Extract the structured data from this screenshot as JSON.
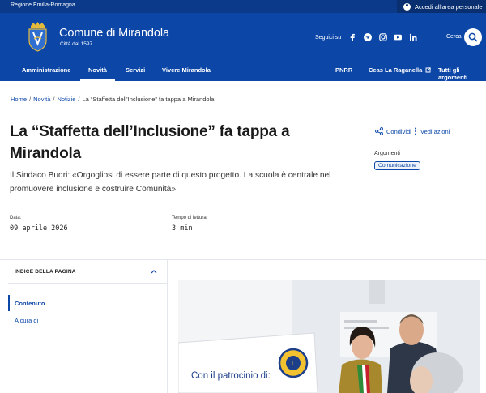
{
  "slim_header": {
    "region": "Regione Emilia-Romagna",
    "login": "Accedi all'area personale"
  },
  "brand": {
    "title": "Comune di Mirandola",
    "subtitle": "Città dal 1597"
  },
  "social": {
    "label": "Seguici su",
    "icons": [
      "facebook-icon",
      "telegram-icon",
      "instagram-icon",
      "youtube-icon",
      "linkedin-icon"
    ]
  },
  "search": {
    "label": "Cerca"
  },
  "nav": {
    "items": [
      "Amministrazione",
      "Novità",
      "Servizi",
      "Vivere Mirandola"
    ],
    "active": "Novità",
    "right_items": [
      "PNRR",
      "Ceas La Raganella",
      "Tutti gli argomenti"
    ]
  },
  "breadcrumb": [
    "Home",
    "Novità",
    "Notizie",
    "La “Staffetta dell’Inclusione” fa tappa a Mirandola"
  ],
  "article": {
    "title": "La “Staffetta dell’Inclusione” fa tappa a Mirandola",
    "lead": "Il Sindaco Budri: «Orgogliosi di essere parte di questo progetto. La scuola è centrale nel promuovere inclusione e costruire Comunità»",
    "date_label": "Data:",
    "date_value": "09 aprile 2026",
    "reading_label": "Tempo di lettura:",
    "reading_value": "3 min"
  },
  "actions": {
    "share": "Condividi",
    "view": "Vedi azioni"
  },
  "topics": {
    "label": "Argomenti",
    "items": [
      "Comunicazione"
    ]
  },
  "page_index": {
    "title": "INDICE DELLA PAGINA",
    "items": [
      "Contenuto",
      "A cura di"
    ]
  },
  "photo": {
    "banner_text": "Con il patrocinio di:"
  },
  "colors": {
    "primary": "#0c47a8",
    "slim": "#0b3a8a"
  }
}
